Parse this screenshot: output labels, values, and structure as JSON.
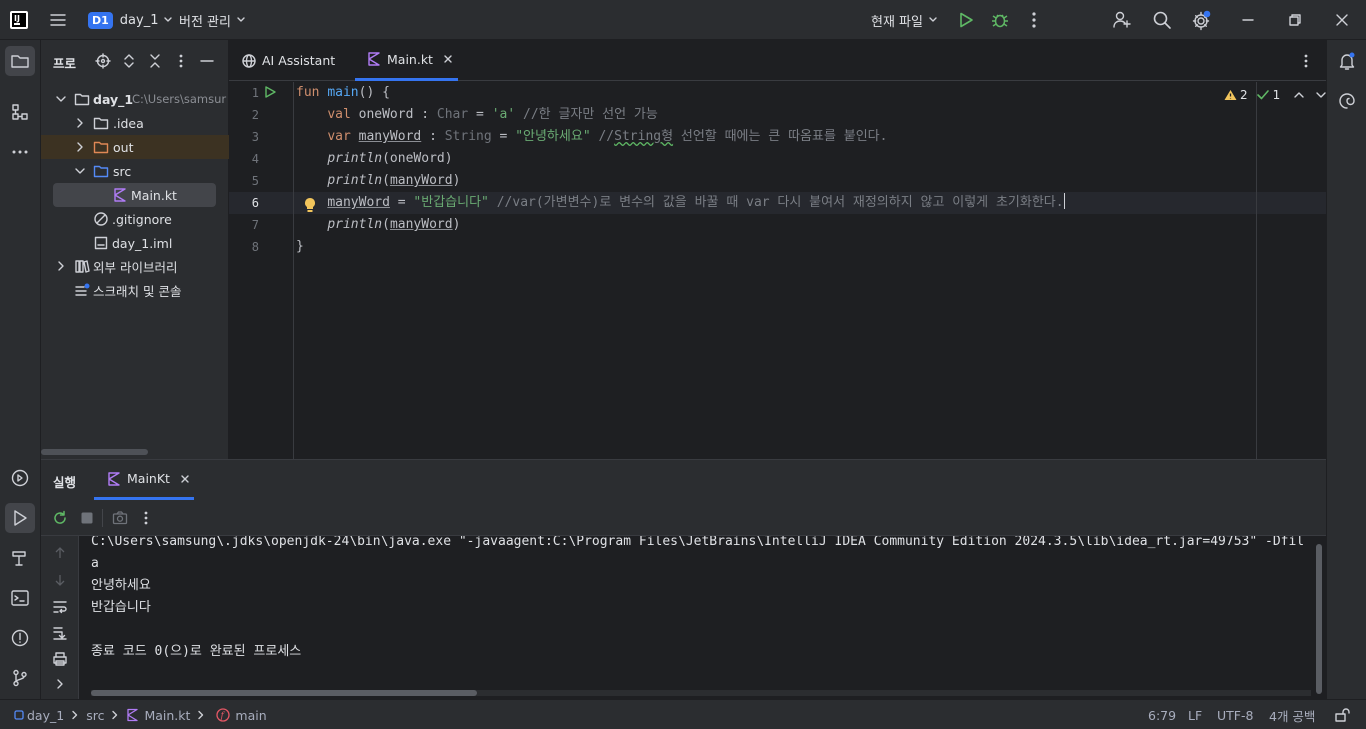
{
  "titlebar": {
    "project_badge": "D1",
    "project_name": "day_1",
    "vcs_label": "버전 관리",
    "run_config": "현재 파일"
  },
  "project_panel": {
    "title": "프로",
    "items": [
      {
        "label": "day_1",
        "path": "C:\\Users\\samsur"
      },
      {
        "label": ".idea"
      },
      {
        "label": "out"
      },
      {
        "label": "src"
      },
      {
        "label": "Main.kt"
      },
      {
        "label": ".gitignore"
      },
      {
        "label": "day_1.iml"
      },
      {
        "label": "외부 라이브러리"
      },
      {
        "label": "스크래치 및 콘솔"
      }
    ]
  },
  "editor": {
    "tabs": [
      {
        "label": "AI Assistant"
      },
      {
        "label": "Main.kt"
      }
    ],
    "line_numbers": [
      "1",
      "2",
      "3",
      "4",
      "5",
      "6",
      "7",
      "8"
    ],
    "inspection": {
      "warnings": "2",
      "ok": "1"
    },
    "code": {
      "l1": {
        "kw": "fun",
        "fn": "main",
        "rest": "() {"
      },
      "l2": {
        "kw": "val",
        "name": "oneWord",
        "colon": " : ",
        "type": "Char",
        "eq": " = ",
        "str": "'a'",
        "comment": " //한 글자만 선언 가능"
      },
      "l3": {
        "kw": "var",
        "name": "manyWord",
        "colon": " : ",
        "type": "String",
        "eq": " = ",
        "str": "\"안녕하세요\"",
        "comment_a": " //",
        "comment_b": "String형",
        "comment_c": " 선언할 때에는 큰 따옴표를 붙인다."
      },
      "l4": {
        "fn": "println",
        "args": "(oneWord)"
      },
      "l5": {
        "fn": "println",
        "open": "(",
        "arg": "manyWord",
        "close": ")"
      },
      "l6": {
        "name": "manyWord",
        "eq": " = ",
        "str": "\"반갑습니다\"",
        "comment": " //var(가변변수)로 변수의 값을 바꿀 때 var 다시 붙여서 재정의하지 않고 이렇게 초기화한다."
      },
      "l7": {
        "fn": "println",
        "open": "(",
        "arg": "manyWord",
        "close": ")"
      },
      "l8": {
        "text": "}"
      }
    }
  },
  "run": {
    "title": "실행",
    "tab": "MainKt",
    "output": [
      "C:\\Users\\samsung\\.jdks\\openjdk-24\\bin\\java.exe \"-javaagent:C:\\Program Files\\JetBrains\\IntelliJ IDEA Community Edition 2024.3.5\\lib\\idea_rt.jar=49753\" -Dfil",
      "a",
      "안녕하세요",
      "반갑습니다",
      "",
      "종료 코드 0(으)로 완료된 프로세스"
    ]
  },
  "statusbar": {
    "breadcrumb": [
      "day_1",
      "src",
      "Main.kt",
      "main"
    ],
    "position": "6:79",
    "line_sep": "LF",
    "encoding": "UTF-8",
    "indent": "4개 공백"
  },
  "colors": {
    "accent": "#3574f0",
    "run_green": "#5fb865",
    "warning": "#f2c55c",
    "kotlin": "#b07cf5"
  }
}
